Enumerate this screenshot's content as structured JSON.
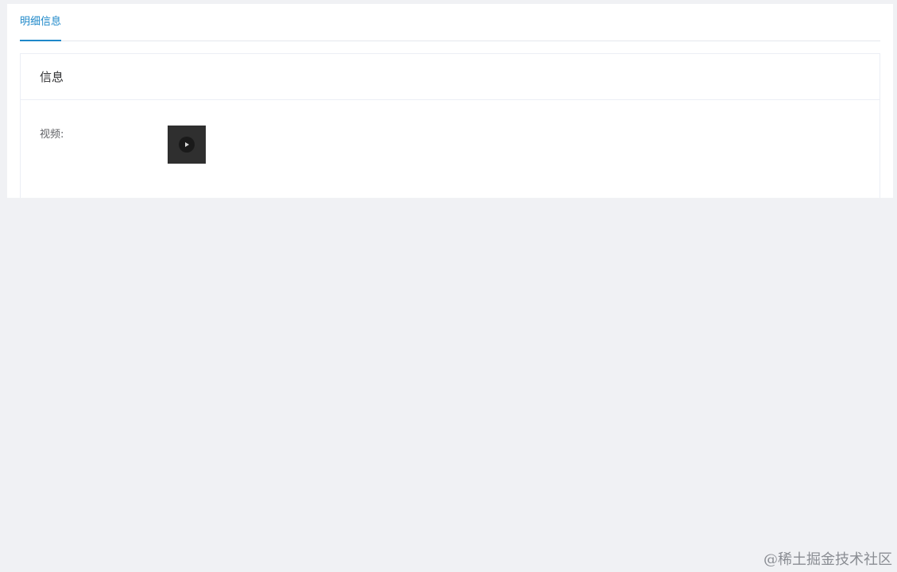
{
  "tabs": [
    {
      "label": "明细信息",
      "active": true
    }
  ],
  "card": {
    "title": "信息",
    "fields": [
      {
        "label": "视频:",
        "type": "video-thumbnail",
        "icon": "play-icon"
      }
    ]
  },
  "watermark": "@稀土掘金技术社区",
  "colors": {
    "accent": "#1e88c9",
    "page_background": "#f0f1f4",
    "panel_background": "#ffffff",
    "video_thumbnail": "#2f2f2f"
  }
}
